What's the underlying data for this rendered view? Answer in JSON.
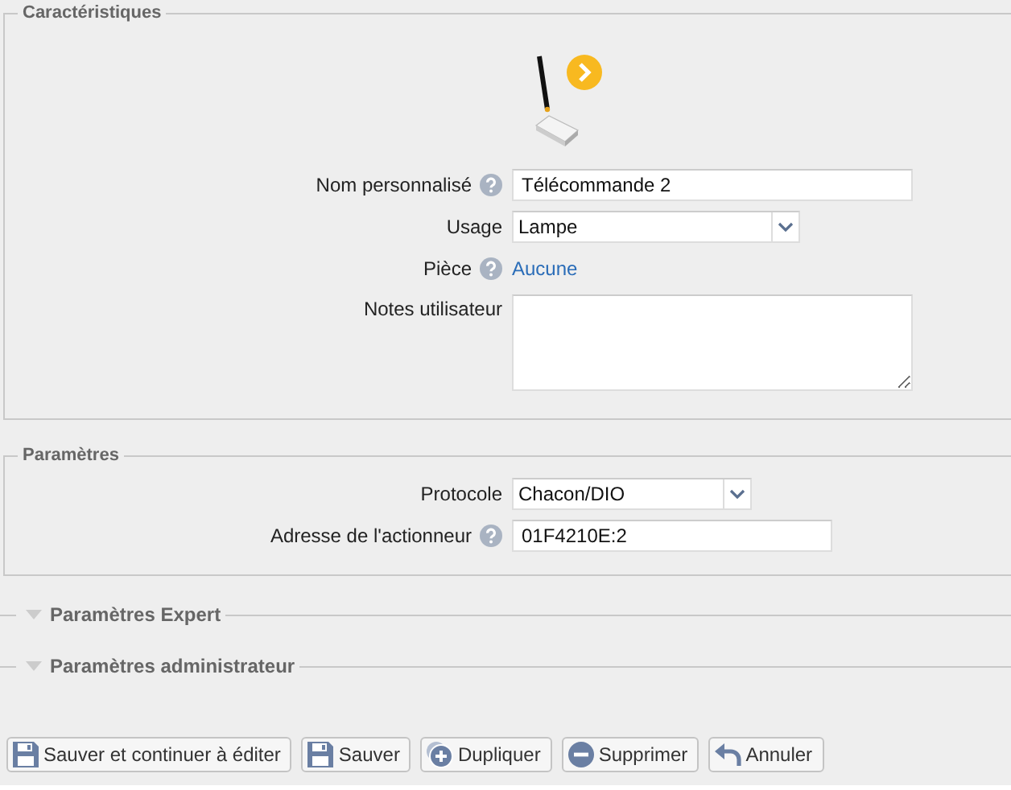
{
  "sections": [
    {
      "title": "Caractéristiques",
      "expanded": true,
      "device_image": true,
      "fields": [
        {
          "kind": "text",
          "label": "Nom personnalisé",
          "help": true,
          "value": "Télécommande 2"
        },
        {
          "kind": "select",
          "label": "Usage",
          "help": false,
          "value": "Lampe"
        },
        {
          "kind": "link",
          "label": "Pièce",
          "help": true,
          "value": "Aucune"
        },
        {
          "kind": "textarea",
          "label": "Notes utilisateur",
          "help": false
        }
      ]
    },
    {
      "title": "Paramètres",
      "expanded": true,
      "fields": [
        {
          "kind": "select",
          "label": "Protocole",
          "help": false,
          "value": "Chacon/DIO"
        },
        {
          "kind": "text",
          "label": "Adresse de l'actionneur",
          "help": true,
          "value": "01F4210E:2"
        }
      ]
    },
    {
      "title": "Paramètres Expert",
      "expanded": false
    },
    {
      "title": "Paramètres administrateur",
      "expanded": false
    }
  ],
  "buttons": [
    {
      "kind": "save",
      "label": "Sauver et continuer à éditer"
    },
    {
      "kind": "save",
      "label": "Sauver"
    },
    {
      "kind": "duplicate",
      "label": "Dupliquer"
    },
    {
      "kind": "delete",
      "label": "Supprimer"
    },
    {
      "kind": "cancel",
      "label": "Annuler"
    }
  ]
}
